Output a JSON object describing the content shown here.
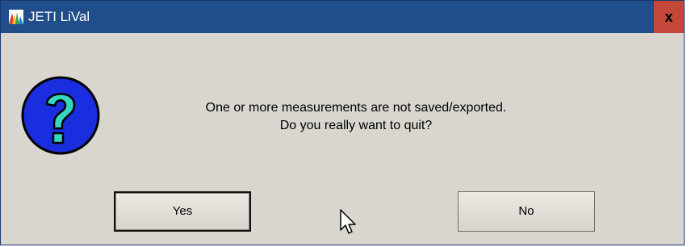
{
  "window": {
    "title": "JETI LiVal",
    "close_label": "x"
  },
  "dialog": {
    "icon": "question-icon",
    "message_line1": "One or more measurements are not saved/exported.",
    "message_line2": "Do you really want to quit?"
  },
  "buttons": {
    "yes_label": "Yes",
    "no_label": "No"
  },
  "colors": {
    "titlebar": "#1f4e8a",
    "close_button": "#c3473a",
    "dialog_background": "#d9d6d0",
    "icon_fill": "#1a2ee0",
    "icon_question_mark": "#35d7c0"
  }
}
